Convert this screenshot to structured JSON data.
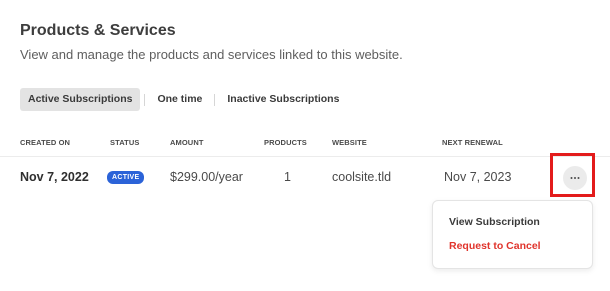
{
  "header": {
    "title": "Products & Services",
    "subtitle": "View and manage the products and services linked to this website."
  },
  "tabs": [
    {
      "label": "Active Subscriptions",
      "active": true
    },
    {
      "label": "One time",
      "active": false
    },
    {
      "label": "Inactive Subscriptions",
      "active": false
    }
  ],
  "table": {
    "columns": {
      "created_on": "CREATED ON",
      "status": "STATUS",
      "amount": "AMOUNT",
      "products": "PRODUCTS",
      "website": "WEBSITE",
      "next_renewal": "NEXT RENEWAL"
    },
    "rows": [
      {
        "created_on": "Nov 7, 2022",
        "status": "ACTIVE",
        "amount": "$299.00/year",
        "products": "1",
        "website": "coolsite.tld",
        "next_renewal": "Nov 7, 2023"
      }
    ]
  },
  "actions_menu": {
    "icon": "more-horizontal-icon",
    "items": [
      {
        "label": "View Subscription"
      },
      {
        "label": "Request to Cancel"
      }
    ]
  },
  "colors": {
    "accent": "#2b63d8",
    "danger": "#e0342c",
    "highlight": "#e31b1b"
  }
}
